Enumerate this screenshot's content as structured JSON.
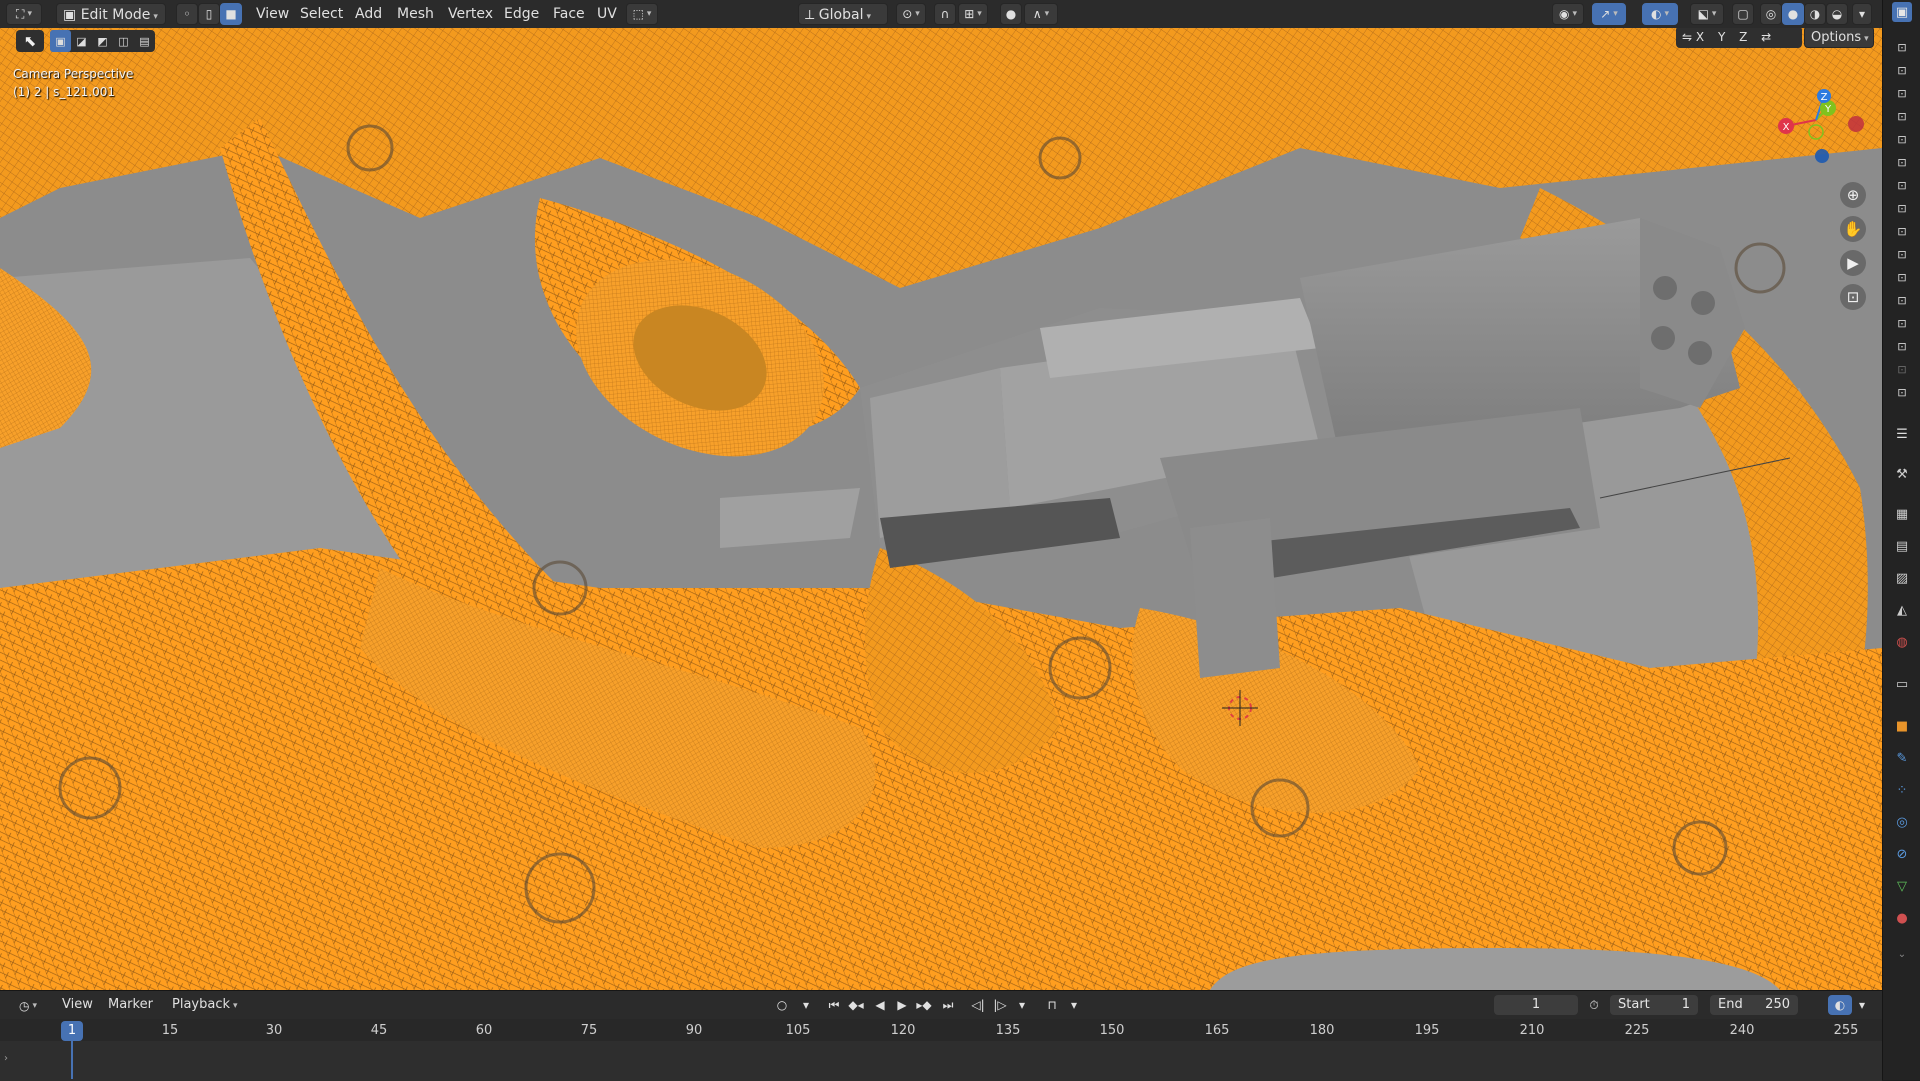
{
  "header": {
    "editor_icon": "3d-viewport-icon",
    "mode": "Edit Mode",
    "menus": [
      "View",
      "Select",
      "Add",
      "Mesh",
      "Vertex",
      "Edge",
      "Face",
      "UV"
    ],
    "orientation": "Global",
    "options": "Options",
    "axes": [
      "X",
      "Y",
      "Z"
    ]
  },
  "viewport": {
    "camera_label": "Camera Perspective",
    "object_label": "(1) 2 | s_121.001"
  },
  "gizmo": {
    "x": "X",
    "y": "Y",
    "z": "Z"
  },
  "timeline": {
    "menus": [
      "View",
      "Marker",
      "Playback"
    ],
    "current_frame": "1",
    "start_label": "Start",
    "start_value": "1",
    "end_label": "End",
    "end_value": "250",
    "ruler_ticks": [
      "15",
      "30",
      "45",
      "60",
      "75",
      "90",
      "105",
      "120",
      "135",
      "150",
      "165",
      "180",
      "195",
      "210",
      "225",
      "240",
      "255"
    ],
    "playhead_frame": "1"
  },
  "colors": {
    "wire_selected": "#ff9c1a",
    "mesh_gray": "#8d8d8d",
    "accent": "#4772b3",
    "axis_x": "#e0344a",
    "axis_y": "#80c21e",
    "axis_z": "#2e7be0"
  }
}
